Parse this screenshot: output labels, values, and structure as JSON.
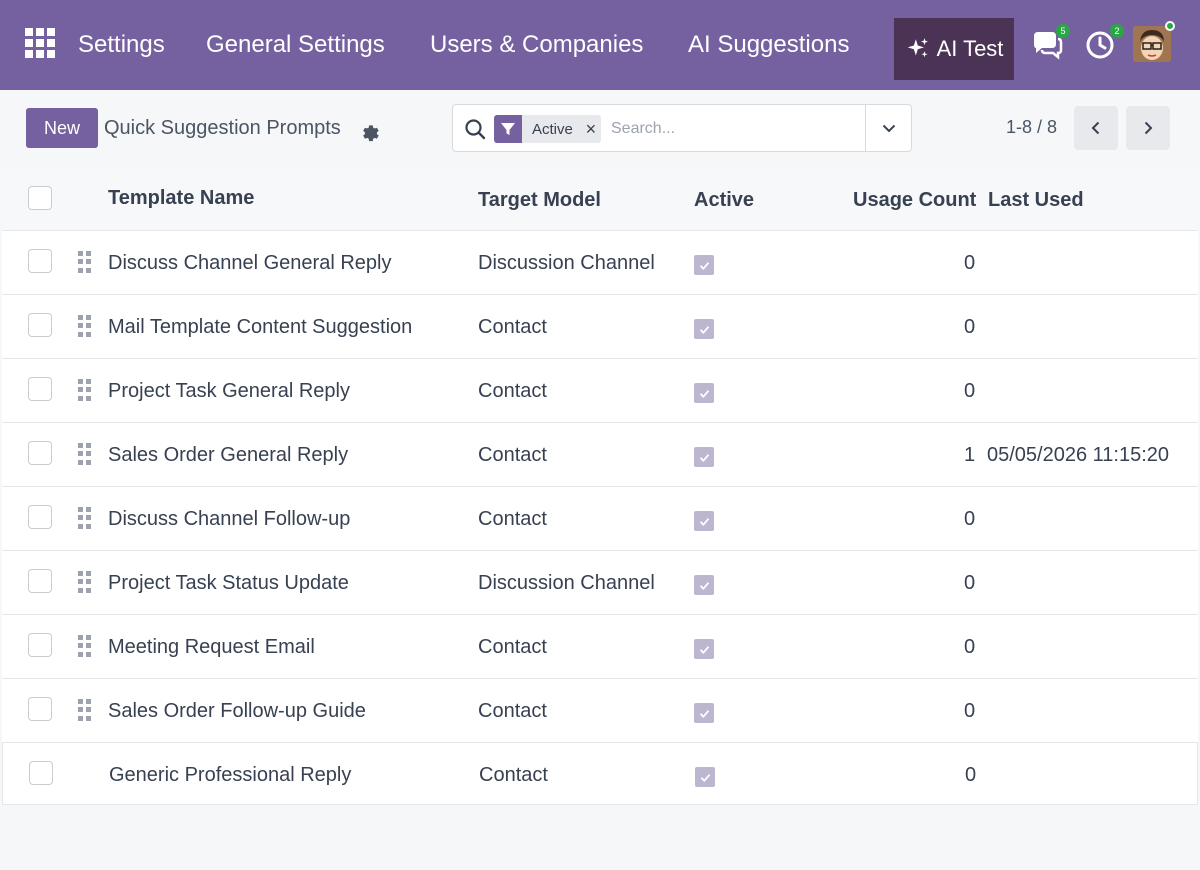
{
  "navbar": {
    "brand": "Settings",
    "menu": [
      "General Settings",
      "Users & Companies",
      "AI Suggestions"
    ],
    "ai_test_label": "AI Test",
    "messages_badge": "5",
    "activities_badge": "2"
  },
  "control_panel": {
    "new_label": "New",
    "breadcrumb": "Quick Suggestion Prompts",
    "search": {
      "facet_label": "Active",
      "facet_remove": "×",
      "placeholder": "Search..."
    },
    "pager_value": "1-8 / 8"
  },
  "table": {
    "headers": {
      "template_name": "Template Name",
      "target_model": "Target Model",
      "active": "Active",
      "usage_count": "Usage Count",
      "last_used": "Last Used"
    },
    "rows": [
      {
        "name": "Discuss Channel General Reply",
        "model": "Discussion Channel",
        "active": true,
        "usage": "0",
        "last_used": ""
      },
      {
        "name": "Mail Template Content Suggestion",
        "model": "Contact",
        "active": true,
        "usage": "0",
        "last_used": ""
      },
      {
        "name": "Project Task General Reply",
        "model": "Contact",
        "active": true,
        "usage": "0",
        "last_used": ""
      },
      {
        "name": "Sales Order General Reply",
        "model": "Contact",
        "active": true,
        "usage": "1",
        "last_used": "05/05/2026 11:15:20"
      },
      {
        "name": "Discuss Channel Follow-up",
        "model": "Contact",
        "active": true,
        "usage": "0",
        "last_used": ""
      },
      {
        "name": "Project Task Status Update",
        "model": "Discussion Channel",
        "active": true,
        "usage": "0",
        "last_used": ""
      },
      {
        "name": "Meeting Request Email",
        "model": "Contact",
        "active": true,
        "usage": "0",
        "last_used": ""
      },
      {
        "name": "Sales Order Follow-up Guide",
        "model": "Contact",
        "active": true,
        "usage": "0",
        "last_used": ""
      },
      {
        "name": "Generic Professional Reply",
        "model": "Contact",
        "active": true,
        "usage": "0",
        "last_used": ""
      }
    ]
  },
  "colors": {
    "navbar": "#7561a0",
    "ai_test_bg": "#4b3355",
    "badge": "#28a745",
    "checkbox_checked": "#bdb6d1"
  }
}
